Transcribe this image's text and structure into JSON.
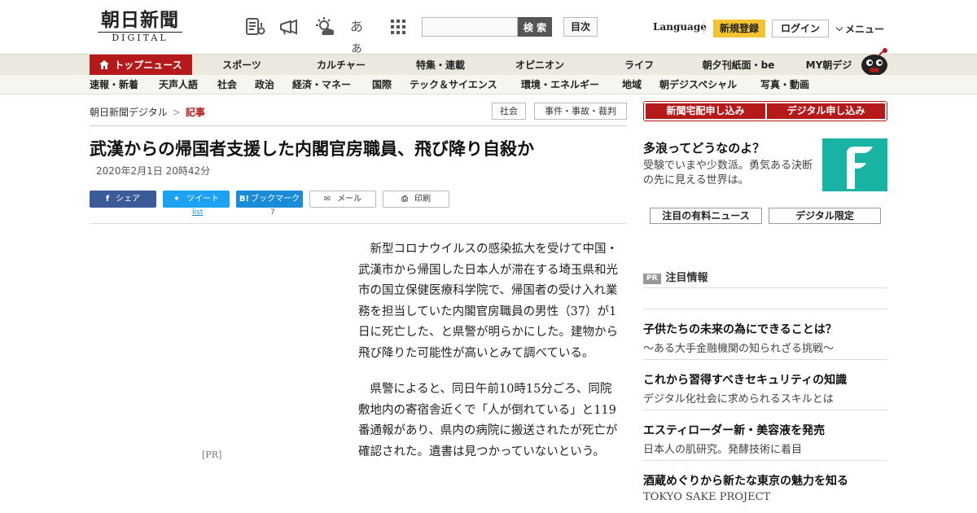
{
  "header": {
    "logo_main": "朝日新聞",
    "logo_sub": "DIGITAL",
    "icons": [
      "news-feed-icon",
      "megaphone-icon",
      "weather-icon",
      "font-size-icon",
      "grid-apps-icon"
    ],
    "font_size_label": "あぁ",
    "search_placeholder": "",
    "search_button": "検 索",
    "toc_button": "目次",
    "language": "Language",
    "register": "新規登録",
    "login": "ログイン",
    "menu": "メニュー"
  },
  "nav_primary": [
    "トップニュース",
    "スポーツ",
    "カルチャー",
    "特集・連載",
    "オピニオン",
    "ライフ",
    "朝夕刊紙面・be",
    "MY朝デジ"
  ],
  "nav_secondary": [
    "速報・新着",
    "天声人語",
    "社会",
    "政治",
    "経済・マネー",
    "国際",
    "テック＆サイエンス",
    "環境・エネルギー",
    "地域",
    "朝デジスペシャル",
    "写真・動画"
  ],
  "breadcrumb": {
    "root": "朝日新聞デジタル",
    "separator": ">",
    "current": "記事"
  },
  "tags": [
    "社会",
    "事件・事故・裁判"
  ],
  "article": {
    "headline": "武漢からの帰国者支援した内閣官房職員、飛び降り自殺か",
    "date": "2020年2月1日 20時42分",
    "paragraphs": [
      "新型コロナウイルスの感染拡大を受けて中国・武漢市から帰国した日本人が滞在する埼玉県和光市の国立保健医療科学院で、帰国者の受け入れ業務を担当していた内閣官房職員の男性（37）が1日に死亡した、と県警が明らかにした。建物から飛び降りた可能性が高いとみて調べている。",
      "県警によると、同日午前10時15分ごろ、同院敷地内の寄宿舎近くで「人が倒れている」と119番通報があり、県内の病院に搬送されたが死亡が確認された。遺書は見つかっていないという。"
    ],
    "ad_label": "[PR]"
  },
  "share": {
    "facebook": "シェア",
    "twitter": "ツイート",
    "twitter_count": "list",
    "hatena": "ブックマーク",
    "hatena_count": "7",
    "mail": "メール",
    "print": "印刷"
  },
  "sidebar": {
    "subscribe_paper": "新聞宅配申し込み",
    "subscribe_digital": "デジタル申し込み",
    "promo_title": "多浪ってどうなのよ？",
    "promo_text": "受験でいまや少数派。勇気ある決断の先に見える世界は。",
    "tab_paid": "注目の有料ニュース",
    "tab_digital": "デジタル限定",
    "pr_badge": "PR",
    "pr_heading": "注目情報",
    "pr_items": [
      {
        "title": "子供たちの未来の為にできることは？",
        "sub": "～ある大手金融機関の知られざる挑戦～"
      },
      {
        "title": "これから習得すべきセキュリティの知識",
        "sub": "デジタル化社会に求められるスキルとは"
      },
      {
        "title": "エスティローダー新・美容液を発売",
        "sub": "日本人の肌研究。発酵技術に着目"
      },
      {
        "title": "酒蔵めぐりから新たな東京の魅力を知る",
        "sub": "TOKYO SAKE PROJECT"
      }
    ]
  },
  "colors": {
    "brand_red": "#b5191a",
    "register_yellow": "#f5c230",
    "facebook_blue": "#3b5a98",
    "twitter_blue": "#1da1f2",
    "hatena_blue": "#1a8bd6",
    "promo_teal": "#19b3a3"
  }
}
